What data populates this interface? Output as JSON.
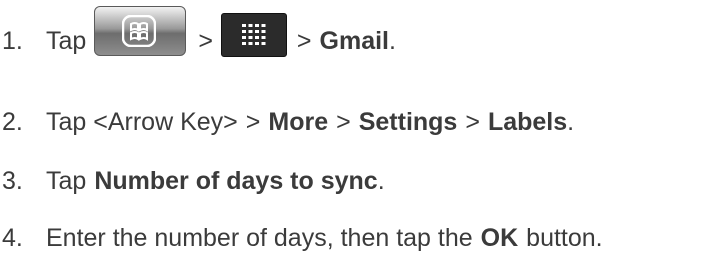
{
  "steps": [
    {
      "number": "1.",
      "text_before": "Tap",
      "icons": [
        "home-key-icon",
        "app-grid-icon"
      ],
      "separator": ">",
      "bold": "Gmail",
      "end": "."
    },
    {
      "number": "2.",
      "text_before": "Tap <Arrow Key>",
      "separator": ">",
      "bold1": "More",
      "bold2": "Settings",
      "bold3": "Labels",
      "end": "."
    },
    {
      "number": "3.",
      "text_before": "Tap",
      "bold": "Number of days to sync",
      "end": "."
    },
    {
      "number": "4.",
      "text_before": "Enter the number of days, then tap the",
      "bold": "OK",
      "text_after": "button."
    }
  ]
}
